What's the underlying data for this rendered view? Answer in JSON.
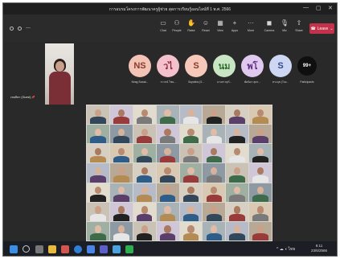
{
  "window": {
    "title": "การอบรมโครงการพัฒนาครูผู้ช่วย สุดการเรียนรู้ออนไลน์ที่ 1 พ.ศ. 2566",
    "controls": [
      "—",
      "▢",
      "✕"
    ]
  },
  "meeting": {
    "status": "---"
  },
  "toolbar": {
    "buttons": [
      {
        "label": "Chat",
        "icon": "chat-icon"
      },
      {
        "label": "People",
        "icon": "people-icon"
      },
      {
        "label": "Raise",
        "icon": "hand-icon"
      },
      {
        "label": "React",
        "icon": "smile-icon"
      },
      {
        "label": "View",
        "icon": "grid-icon"
      },
      {
        "label": "Apps",
        "icon": "apps-icon"
      },
      {
        "label": "More",
        "icon": "more-icon"
      },
      {
        "label": "Camera",
        "icon": "camera-icon"
      },
      {
        "label": "Mic",
        "icon": "mic-icon"
      },
      {
        "label": "Share",
        "icon": "share-icon"
      }
    ],
    "leave_label": "Leave"
  },
  "presenter": {
    "name": "เชลลิตา (Guest)"
  },
  "participants": [
    {
      "initials": "NS",
      "name": "Nirag Suwat...",
      "color": "#f3c4b6",
      "text_color": "#8a3a2a"
    },
    {
      "initials": "วไ",
      "name": "วรวรณ์ ไชย...",
      "color": "#f4c0cc",
      "text_color": "#8f2c44"
    },
    {
      "initials": "S",
      "name": "Supattra (G...",
      "color": "#f6c8b9",
      "text_color": "#8a3a2a"
    },
    {
      "initials": "นม",
      "name": "นางสาวสุภั...",
      "color": "#c8e6c3",
      "text_color": "#2e6a2b"
    },
    {
      "initials": "พโ",
      "name": "พัดนิดา สุดร...",
      "color": "#e0c9ef",
      "text_color": "#5c2f7e"
    },
    {
      "initials": "S",
      "name": "ทรงนุช (Tuc...",
      "color": "#cdd6f2",
      "text_color": "#34488a"
    },
    {
      "initials": "99+",
      "name": "Participants",
      "color": "#0f0f0f",
      "text_color": "#ffffff"
    }
  ],
  "taskbar": {
    "tray": "^ ☁ ◖ ",
    "lang": "ไทย",
    "time": "9:11",
    "date": "23/6/2566"
  }
}
